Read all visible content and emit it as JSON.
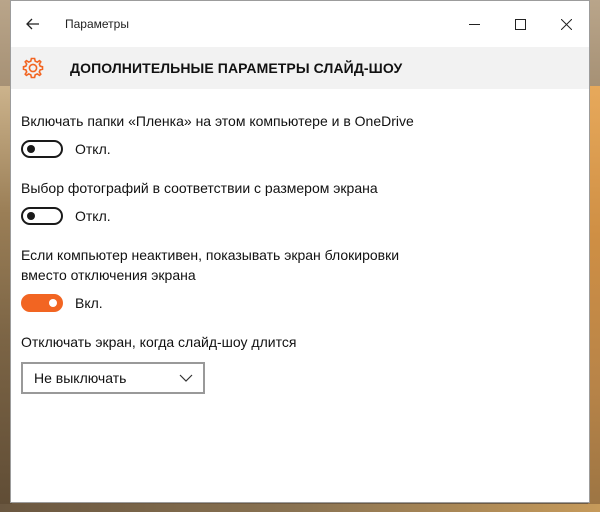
{
  "window": {
    "title": "Параметры"
  },
  "header": {
    "icon": "gear-icon",
    "title": "ДОПОЛНИТЕЛЬНЫЕ ПАРАМЕТРЫ СЛАЙД-ШОУ"
  },
  "settings": [
    {
      "label": "Включать папки «Пленка» на этом компьютере и в OneDrive",
      "state": "Откл.",
      "on": false
    },
    {
      "label": "Выбор фотографий в соответствии с размером экрана",
      "state": "Откл.",
      "on": false
    },
    {
      "label_line1": "Если компьютер неактивен, показывать экран блокировки",
      "label_line2": "вместо отключения экрана",
      "state": "Вкл.",
      "on": true
    }
  ],
  "screen_off": {
    "label": "Отключать экран, когда слайд-шоу длится",
    "selected": "Не выключать"
  },
  "colors": {
    "accent": "#f26522"
  }
}
